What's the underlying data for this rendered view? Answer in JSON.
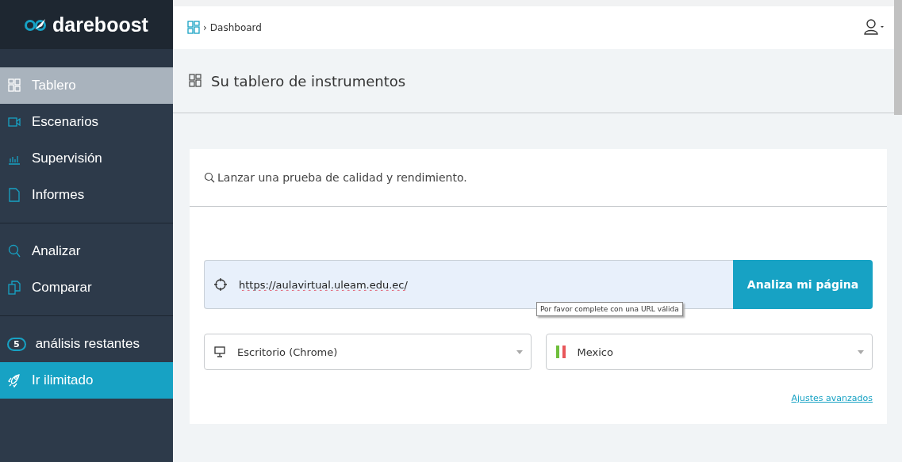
{
  "logo": {
    "text": "dareboost"
  },
  "sidebar": {
    "sections": [
      {
        "items": [
          {
            "kind": "nav",
            "label": "Tablero",
            "selected": true
          },
          {
            "kind": "nav",
            "label": "Escenarios",
            "selected": false
          },
          {
            "kind": "nav",
            "label": "Supervisión",
            "selected": false
          },
          {
            "kind": "nav",
            "label": "Informes",
            "selected": false
          }
        ]
      },
      {
        "items": [
          {
            "kind": "nav",
            "label": "Analizar",
            "selected": false
          },
          {
            "kind": "nav",
            "label": "Comparar",
            "selected": false
          }
        ]
      },
      {
        "items": [
          {
            "kind": "counter",
            "count": "5",
            "label": "análisis restantes"
          },
          {
            "kind": "upgrade",
            "label": "Ir ilimitado"
          }
        ]
      }
    ]
  },
  "breadcrumb": {
    "separator": "›",
    "current": "Dashboard"
  },
  "page_title": "Su tablero de instrumentos",
  "card": {
    "title": "Lanzar una prueba de calidad y rendimiento.",
    "url_field": {
      "value": "https://aulavirtual.uleam.edu.ec/"
    },
    "submit_button": "Analiza mi página",
    "tooltip": "Por favor complete con una URL válida",
    "device_select": {
      "value": "Escritorio (Chrome)"
    },
    "location_select": {
      "value": "Mexico"
    },
    "advanced_link": "Ajustes avanzados"
  }
}
